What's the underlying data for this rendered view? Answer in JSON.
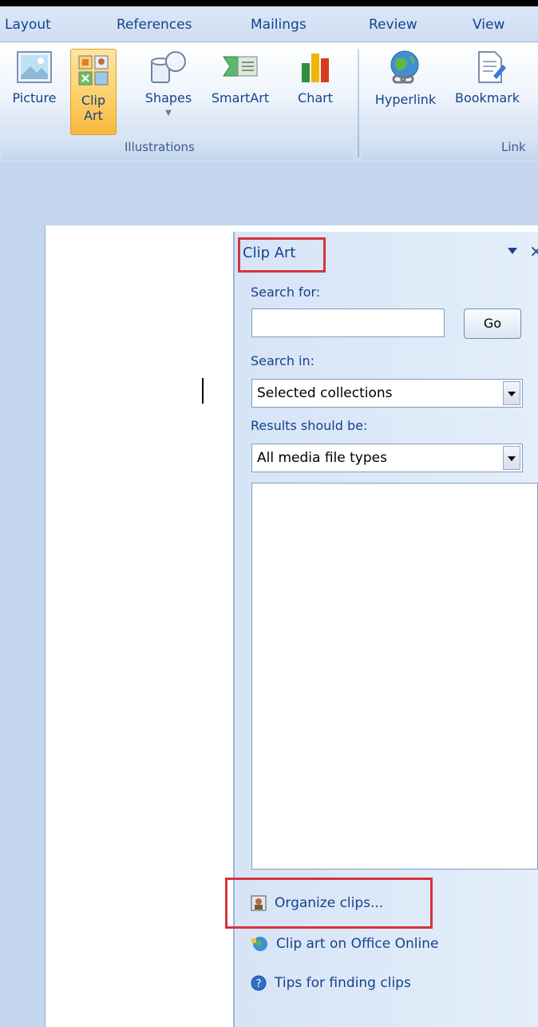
{
  "tabs": [
    "Layout",
    "References",
    "Mailings",
    "Review",
    "View"
  ],
  "ribbon": {
    "illustrations": {
      "label": "Illustrations",
      "buttons": {
        "picture": "Picture",
        "clipart_line1": "Clip",
        "clipart_line2": "Art",
        "shapes": "Shapes",
        "smartart": "SmartArt",
        "chart": "Chart"
      }
    },
    "links": {
      "label": "Link",
      "buttons": {
        "hyperlink": "Hyperlink",
        "bookmark": "Bookmark"
      }
    }
  },
  "clipart_pane": {
    "title": "Clip Art",
    "search_for_label": "Search for:",
    "search_value": "",
    "go_label": "Go",
    "search_in_label": "Search in:",
    "search_in_value": "Selected collections",
    "results_label": "Results should be:",
    "results_value": "All media file types",
    "links": {
      "organize": "Organize clips...",
      "online": "Clip art on Office Online",
      "tips": "Tips for finding clips"
    }
  },
  "colors": {
    "highlight": "#d2363a",
    "accent": "#15428b"
  }
}
